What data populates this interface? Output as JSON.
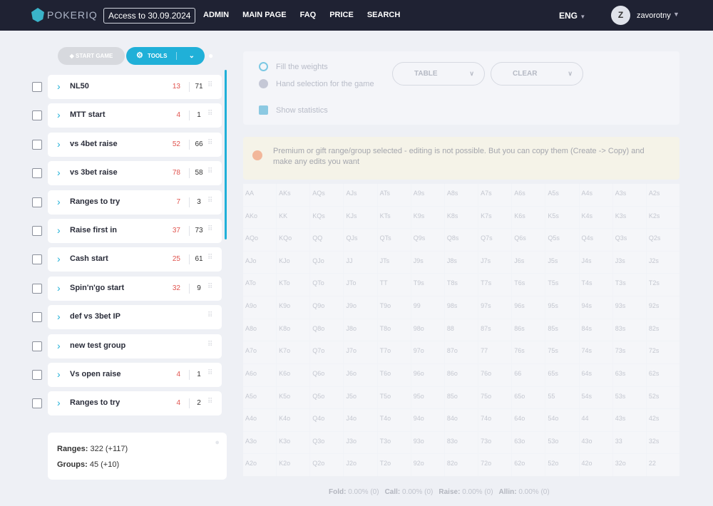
{
  "header": {
    "logo": "POKERIQ",
    "access": "Access to 30.09.2024",
    "nav": [
      "ADMIN",
      "MAIN PAGE",
      "FAQ",
      "PRICE",
      "SEARCH"
    ],
    "lang": "ENG",
    "avatar": "Z",
    "user": "zavorotny"
  },
  "toolbar": {
    "start_game": "START GAME",
    "tools": "TOOLS"
  },
  "groups": [
    {
      "name": "NL50",
      "ranges": "13",
      "groups": "71"
    },
    {
      "name": "MTT start",
      "ranges": "4",
      "groups": "1"
    },
    {
      "name": "vs 4bet raise",
      "ranges": "52",
      "groups": "66"
    },
    {
      "name": "vs 3bet raise",
      "ranges": "78",
      "groups": "58"
    },
    {
      "name": "Ranges to try",
      "ranges": "7",
      "groups": "3"
    },
    {
      "name": "Raise first in",
      "ranges": "37",
      "groups": "73"
    },
    {
      "name": "Cash start",
      "ranges": "25",
      "groups": "61"
    },
    {
      "name": "Spin'n'go start",
      "ranges": "32",
      "groups": "9"
    },
    {
      "name": "def vs 3bet IP",
      "ranges": "",
      "groups": ""
    },
    {
      "name": "new test group",
      "ranges": "",
      "groups": ""
    },
    {
      "name": "Vs open raise",
      "ranges": "4",
      "groups": "1"
    },
    {
      "name": "Ranges to try",
      "ranges": "4",
      "groups": "2"
    }
  ],
  "stats": {
    "ranges_label": "Ranges:",
    "ranges_value": "322 (+117)",
    "groups_label": "Groups:",
    "groups_value": "45 (+10)"
  },
  "controls": {
    "fill_weights": "Fill the weights",
    "hand_selection": "Hand selection for the game",
    "show_statistics": "Show statistics",
    "table": "TABLE",
    "clear": "CLEAR"
  },
  "alert": "Premium or gift range/group selected - editing is not possible. But you can copy them (Create -> Copy) and make any edits you want",
  "hand_grid": [
    [
      "AA",
      "AKs",
      "AQs",
      "AJs",
      "ATs",
      "A9s",
      "A8s",
      "A7s",
      "A6s",
      "A5s",
      "A4s",
      "A3s",
      "A2s"
    ],
    [
      "AKo",
      "KK",
      "KQs",
      "KJs",
      "KTs",
      "K9s",
      "K8s",
      "K7s",
      "K6s",
      "K5s",
      "K4s",
      "K3s",
      "K2s"
    ],
    [
      "AQo",
      "KQo",
      "QQ",
      "QJs",
      "QTs",
      "Q9s",
      "Q8s",
      "Q7s",
      "Q6s",
      "Q5s",
      "Q4s",
      "Q3s",
      "Q2s"
    ],
    [
      "AJo",
      "KJo",
      "QJo",
      "JJ",
      "JTs",
      "J9s",
      "J8s",
      "J7s",
      "J6s",
      "J5s",
      "J4s",
      "J3s",
      "J2s"
    ],
    [
      "ATo",
      "KTo",
      "QTo",
      "JTo",
      "TT",
      "T9s",
      "T8s",
      "T7s",
      "T6s",
      "T5s",
      "T4s",
      "T3s",
      "T2s"
    ],
    [
      "A9o",
      "K9o",
      "Q9o",
      "J9o",
      "T9o",
      "99",
      "98s",
      "97s",
      "96s",
      "95s",
      "94s",
      "93s",
      "92s"
    ],
    [
      "A8o",
      "K8o",
      "Q8o",
      "J8o",
      "T8o",
      "98o",
      "88",
      "87s",
      "86s",
      "85s",
      "84s",
      "83s",
      "82s"
    ],
    [
      "A7o",
      "K7o",
      "Q7o",
      "J7o",
      "T7o",
      "97o",
      "87o",
      "77",
      "76s",
      "75s",
      "74s",
      "73s",
      "72s"
    ],
    [
      "A6o",
      "K6o",
      "Q6o",
      "J6o",
      "T6o",
      "96o",
      "86o",
      "76o",
      "66",
      "65s",
      "64s",
      "63s",
      "62s"
    ],
    [
      "A5o",
      "K5o",
      "Q5o",
      "J5o",
      "T5o",
      "95o",
      "85o",
      "75o",
      "65o",
      "55",
      "54s",
      "53s",
      "52s"
    ],
    [
      "A4o",
      "K4o",
      "Q4o",
      "J4o",
      "T4o",
      "94o",
      "84o",
      "74o",
      "64o",
      "54o",
      "44",
      "43s",
      "42s"
    ],
    [
      "A3o",
      "K3o",
      "Q3o",
      "J3o",
      "T3o",
      "93o",
      "83o",
      "73o",
      "63o",
      "53o",
      "43o",
      "33",
      "32s"
    ],
    [
      "A2o",
      "K2o",
      "Q2o",
      "J2o",
      "T2o",
      "92o",
      "82o",
      "72o",
      "62o",
      "52o",
      "42o",
      "32o",
      "22"
    ]
  ],
  "footer": [
    {
      "label": "Fold:",
      "value": "0.00% (0)"
    },
    {
      "label": "Call:",
      "value": "0.00% (0)"
    },
    {
      "label": "Raise:",
      "value": "0.00% (0)"
    },
    {
      "label": "Allin:",
      "value": "0.00% (0)"
    }
  ]
}
